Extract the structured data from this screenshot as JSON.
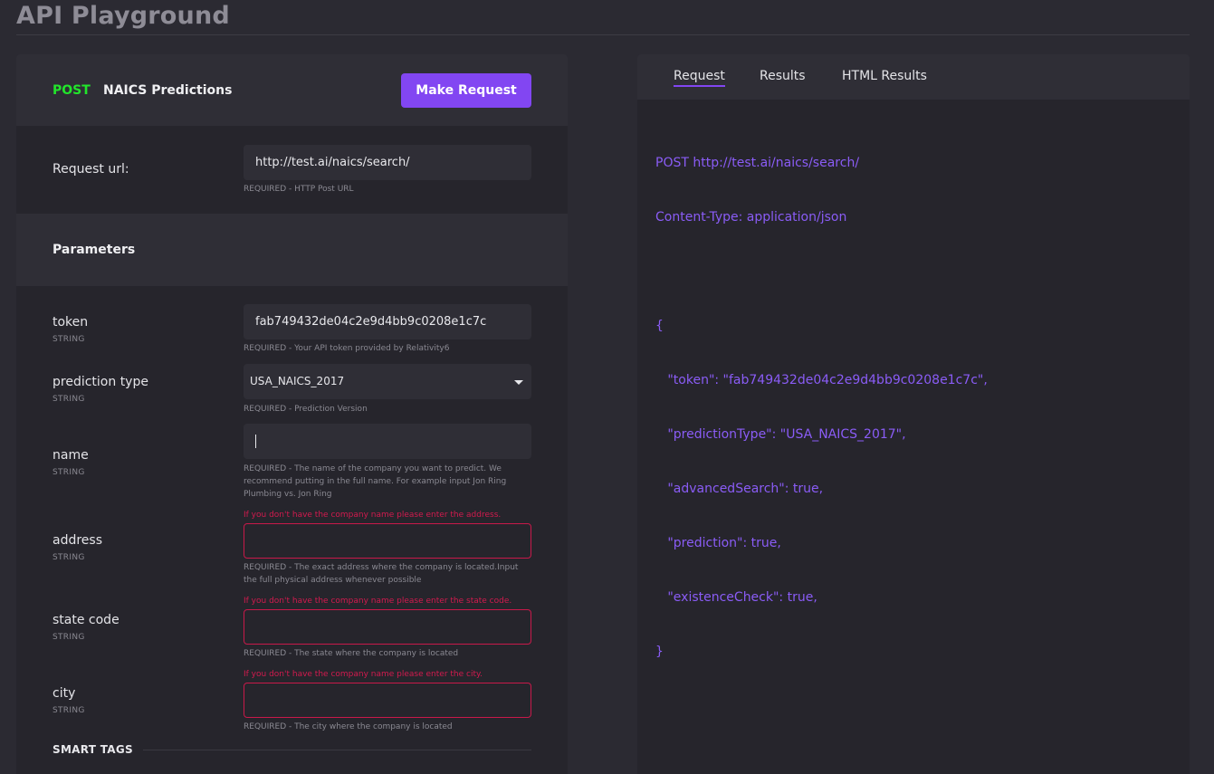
{
  "page": {
    "title": "API Playground"
  },
  "endpoint": {
    "method": "POST",
    "name": "NAICS Predictions",
    "make_request_label": "Make Request"
  },
  "request_url": {
    "label": "Request url:",
    "value": "http://test.ai/naics/search/",
    "help": "REQUIRED - HTTP Post URL"
  },
  "parameters_title": "Parameters",
  "params": {
    "token": {
      "label": "token",
      "type": "STRING",
      "value": "fab749432de04c2e9d4bb9c0208e1c7c",
      "help": "REQUIRED - Your API token provided by Relativity6"
    },
    "prediction_type": {
      "label": "prediction type",
      "type": "STRING",
      "value": "USA_NAICS_2017",
      "help": "REQUIRED - Prediction Version"
    },
    "name": {
      "label": "name",
      "type": "STRING",
      "value": "",
      "help": "REQUIRED - The name of the company you want to predict. We recommend putting in the full name. For example input Jon Ring Plumbing vs. Jon Ring"
    },
    "address": {
      "label": "address",
      "type": "STRING",
      "value": "",
      "warning": "If you don't have the company name please enter the address.",
      "help": "REQUIRED - The exact address where the company is located.Input the full physical address whenever possible"
    },
    "state_code": {
      "label": "state code",
      "type": "STRING",
      "value": "",
      "warning": "If you don't have the company name please enter the state code.",
      "help": "REQUIRED - The state where the company is located"
    },
    "city": {
      "label": "city",
      "type": "STRING",
      "value": "",
      "warning": "If you don't have the company name please enter the city.",
      "help": "REQUIRED - The city where the company is located"
    }
  },
  "smart_tags_title": "SMART TAGS",
  "tabs": [
    {
      "label": "Request",
      "active": true
    },
    {
      "label": "Results",
      "active": false
    },
    {
      "label": "HTML Results",
      "active": false
    }
  ],
  "request_preview": [
    "POST http://test.ai/naics/search/",
    "Content-Type: application/json",
    "",
    "{",
    "   \"token\": \"fab749432de04c2e9d4bb9c0208e1c7c\",",
    "   \"predictionType\": \"USA_NAICS_2017\",",
    "   \"advancedSearch\": true,",
    "   \"prediction\": true,",
    "   \"existenceCheck\": true,",
    "}"
  ],
  "colors": {
    "accent": "#8246f2",
    "method_post": "#22e52b",
    "error": "#c8194a",
    "code": "#8a5cf6"
  }
}
